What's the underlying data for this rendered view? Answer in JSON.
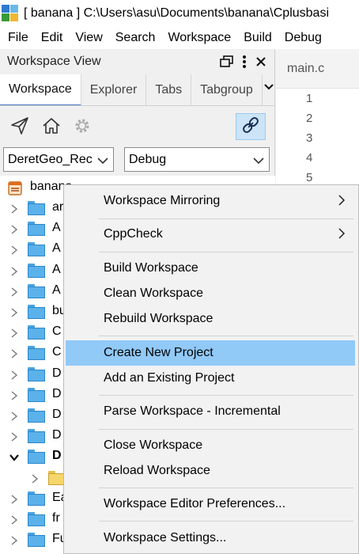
{
  "window": {
    "title": "[ banana ] C:\\Users\\asu\\Documents\\banana\\Cplusbasi",
    "icon": "codelite-app-icon"
  },
  "menubar": [
    "File",
    "Edit",
    "View",
    "Search",
    "Workspace",
    "Build",
    "Debug"
  ],
  "panel": {
    "title": "Workspace View",
    "tabs": [
      "Workspace",
      "Explorer",
      "Tabs",
      "Tabgroup"
    ],
    "active_tab": "Workspace",
    "toolbar_icons": [
      "send-icon",
      "home-icon",
      "gear-icon",
      "link-icon"
    ],
    "project_select": "DeretGeo_Rec",
    "config_select": "Debug"
  },
  "tree": {
    "root_label": "banana",
    "rows": [
      {
        "label": "ar",
        "twisty": "collapsed",
        "folder": "blue",
        "bold": false
      },
      {
        "label": "A",
        "twisty": "collapsed",
        "folder": "blue",
        "bold": false
      },
      {
        "label": "A",
        "twisty": "collapsed",
        "folder": "blue",
        "bold": false
      },
      {
        "label": "A",
        "twisty": "collapsed",
        "folder": "blue",
        "bold": false
      },
      {
        "label": "A",
        "twisty": "collapsed",
        "folder": "blue",
        "bold": false
      },
      {
        "label": "bu",
        "twisty": "collapsed",
        "folder": "blue",
        "bold": false
      },
      {
        "label": "C",
        "twisty": "collapsed",
        "folder": "blue",
        "bold": false
      },
      {
        "label": "C",
        "twisty": "collapsed",
        "folder": "blue",
        "bold": false
      },
      {
        "label": "D",
        "twisty": "collapsed",
        "folder": "blue",
        "bold": false
      },
      {
        "label": "D",
        "twisty": "collapsed",
        "folder": "blue",
        "bold": false
      },
      {
        "label": "D",
        "twisty": "collapsed",
        "folder": "blue",
        "bold": false
      },
      {
        "label": "D",
        "twisty": "collapsed",
        "folder": "blue",
        "bold": false
      },
      {
        "label": "D",
        "twisty": "expanded",
        "folder": "blue",
        "bold": true
      },
      {
        "label": "",
        "twisty": "collapsed",
        "folder": "yellow",
        "bold": false,
        "indent": true
      },
      {
        "label": "Ea",
        "twisty": "collapsed",
        "folder": "blue",
        "bold": false
      },
      {
        "label": "fr",
        "twisty": "collapsed",
        "folder": "blue",
        "bold": false
      },
      {
        "label": "Fu",
        "twisty": "collapsed",
        "folder": "blue",
        "bold": false
      }
    ]
  },
  "editor": {
    "tab": "main.c",
    "line_numbers": [
      "1",
      "2",
      "3",
      "4",
      "5"
    ]
  },
  "context_menu": {
    "items": [
      {
        "label": "Workspace Mirroring",
        "submenu": true
      },
      {
        "label": "CppCheck",
        "submenu": true
      },
      {
        "label": "Build Workspace"
      },
      {
        "label": "Clean Workspace"
      },
      {
        "label": "Rebuild Workspace"
      },
      {
        "label": "Create New Project",
        "highlighted": true
      },
      {
        "label": "Add an Existing Project"
      },
      {
        "label": "Parse Workspace - Incremental"
      },
      {
        "label": "Close Workspace"
      },
      {
        "label": "Reload Workspace"
      },
      {
        "label": "Workspace Editor Preferences..."
      },
      {
        "label": "Workspace Settings..."
      }
    ]
  },
  "colors": {
    "highlight": "#91c9f7",
    "active_tab_accent": "#4a78c8",
    "folder_blue": "#5bb1ea",
    "folder_yellow": "#f6d66a"
  }
}
